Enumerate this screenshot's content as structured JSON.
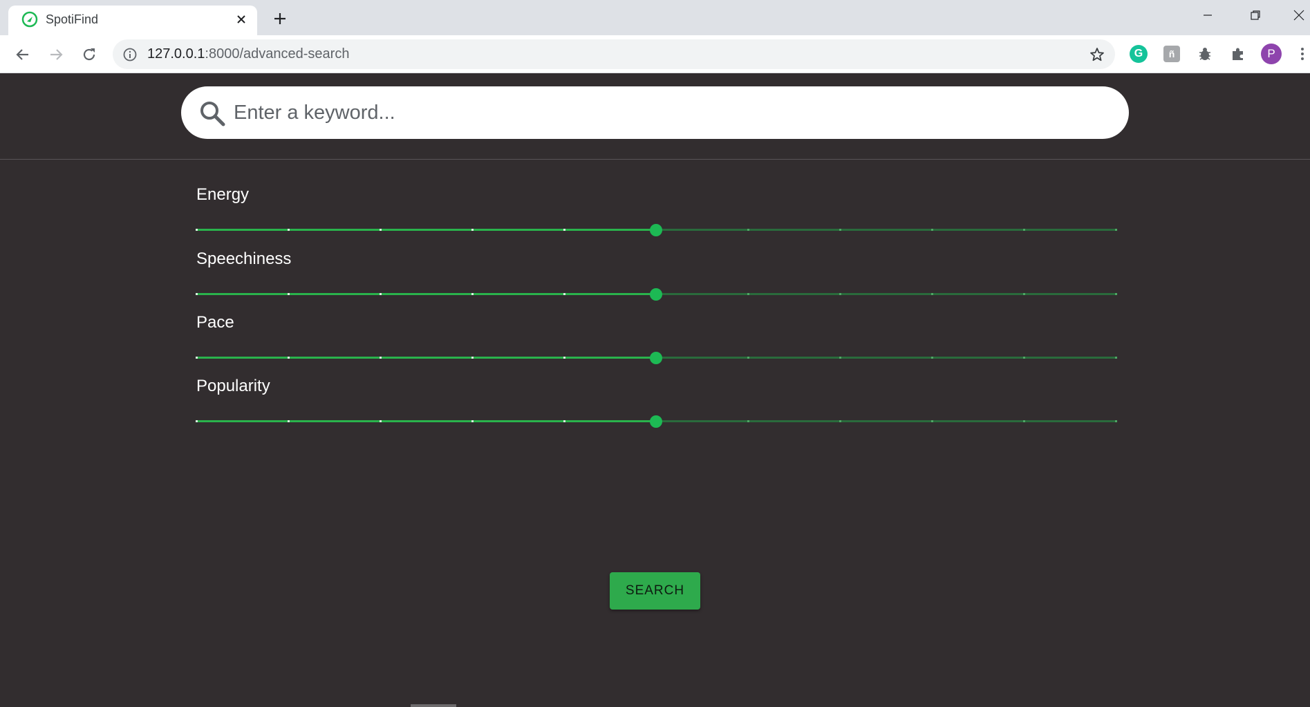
{
  "browser": {
    "tab_title": "SpotiFind",
    "url_host": "127.0.0.1",
    "url_path": ":8000/advanced-search",
    "profile_initial": "P",
    "extensions": [
      "grammarly-icon",
      "extension-gray-icon",
      "bug-icon",
      "puzzle-icon"
    ]
  },
  "search": {
    "placeholder": "Enter a keyword..."
  },
  "sliders": [
    {
      "label": "Energy",
      "value": 0.5
    },
    {
      "label": "Speechiness",
      "value": 0.5
    },
    {
      "label": "Pace",
      "value": 0.5
    },
    {
      "label": "Popularity",
      "value": 0.5
    }
  ],
  "slider_steps": 10,
  "actions": {
    "search_label": "SEARCH"
  },
  "colors": {
    "page_background": "#322d2f",
    "accent": "#1db954",
    "track_fill": "#2ab34c",
    "track_rest": "#2a6b3c",
    "button": "#2eaa4c"
  }
}
